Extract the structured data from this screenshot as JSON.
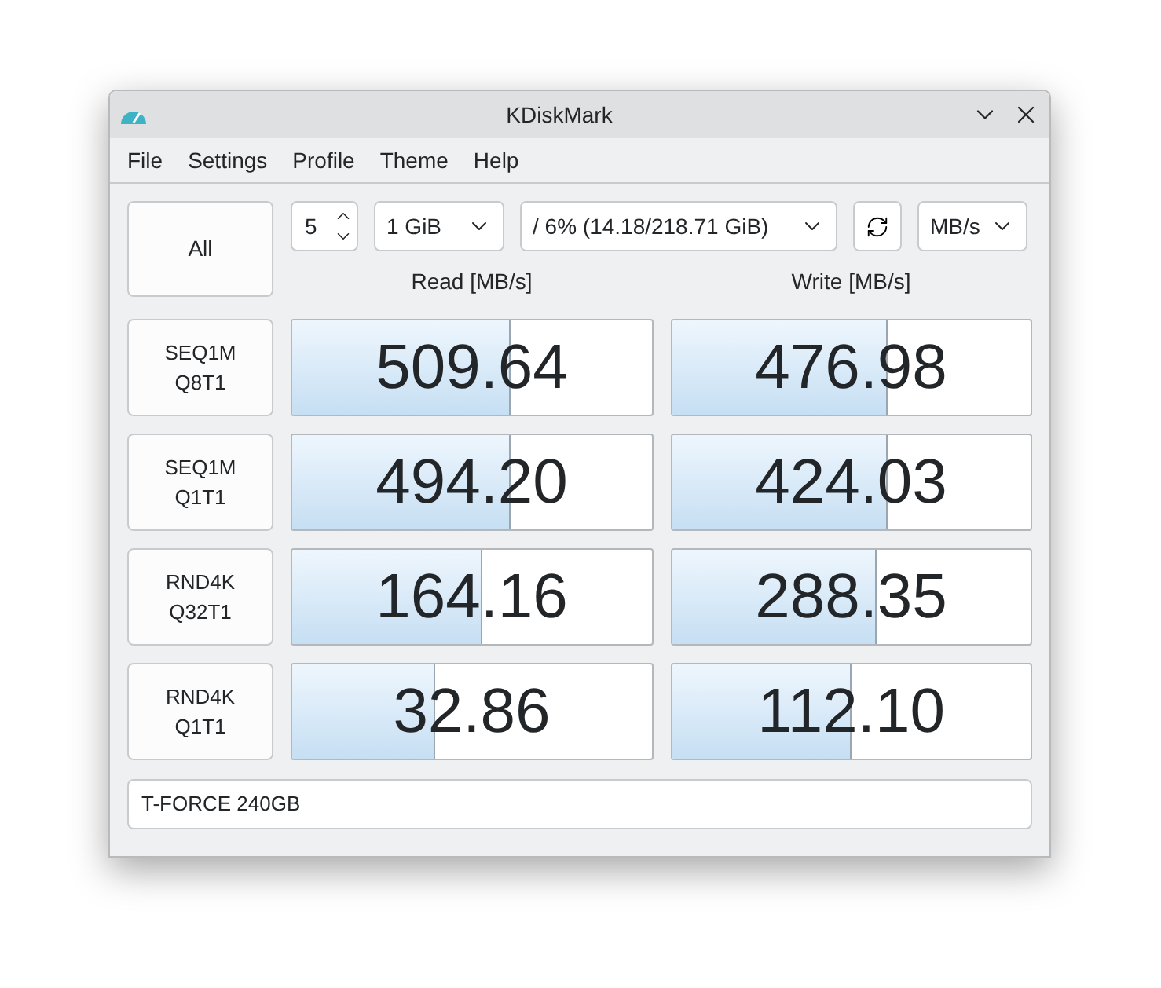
{
  "window": {
    "title": "KDiskMark"
  },
  "menu": [
    "File",
    "Settings",
    "Profile",
    "Theme",
    "Help"
  ],
  "toolbar": {
    "all_button": "All",
    "runs": "5",
    "size": "1 GiB",
    "target": "/ 6% (14.18/218.71 GiB)",
    "unit": "MB/s"
  },
  "headers": {
    "read": "Read [MB/s]",
    "write": "Write [MB/s]"
  },
  "tests": [
    {
      "name": "SEQ1M\nQ8T1",
      "read": {
        "value": "509.64",
        "level": 0.61
      },
      "write": {
        "value": "476.98",
        "level": 0.6
      }
    },
    {
      "name": "SEQ1M\nQ1T1",
      "read": {
        "value": "494.20",
        "level": 0.61
      },
      "write": {
        "value": "424.03",
        "level": 0.6
      }
    },
    {
      "name": "RND4K\nQ32T1",
      "read": {
        "value": "164.16",
        "level": 0.53
      },
      "write": {
        "value": "288.35",
        "level": 0.57
      }
    },
    {
      "name": "RND4K\nQ1T1",
      "read": {
        "value": "32.86",
        "level": 0.4
      },
      "write": {
        "value": "112.10",
        "level": 0.5
      }
    }
  ],
  "comment": {
    "value": "T-FORCE 240GB"
  }
}
